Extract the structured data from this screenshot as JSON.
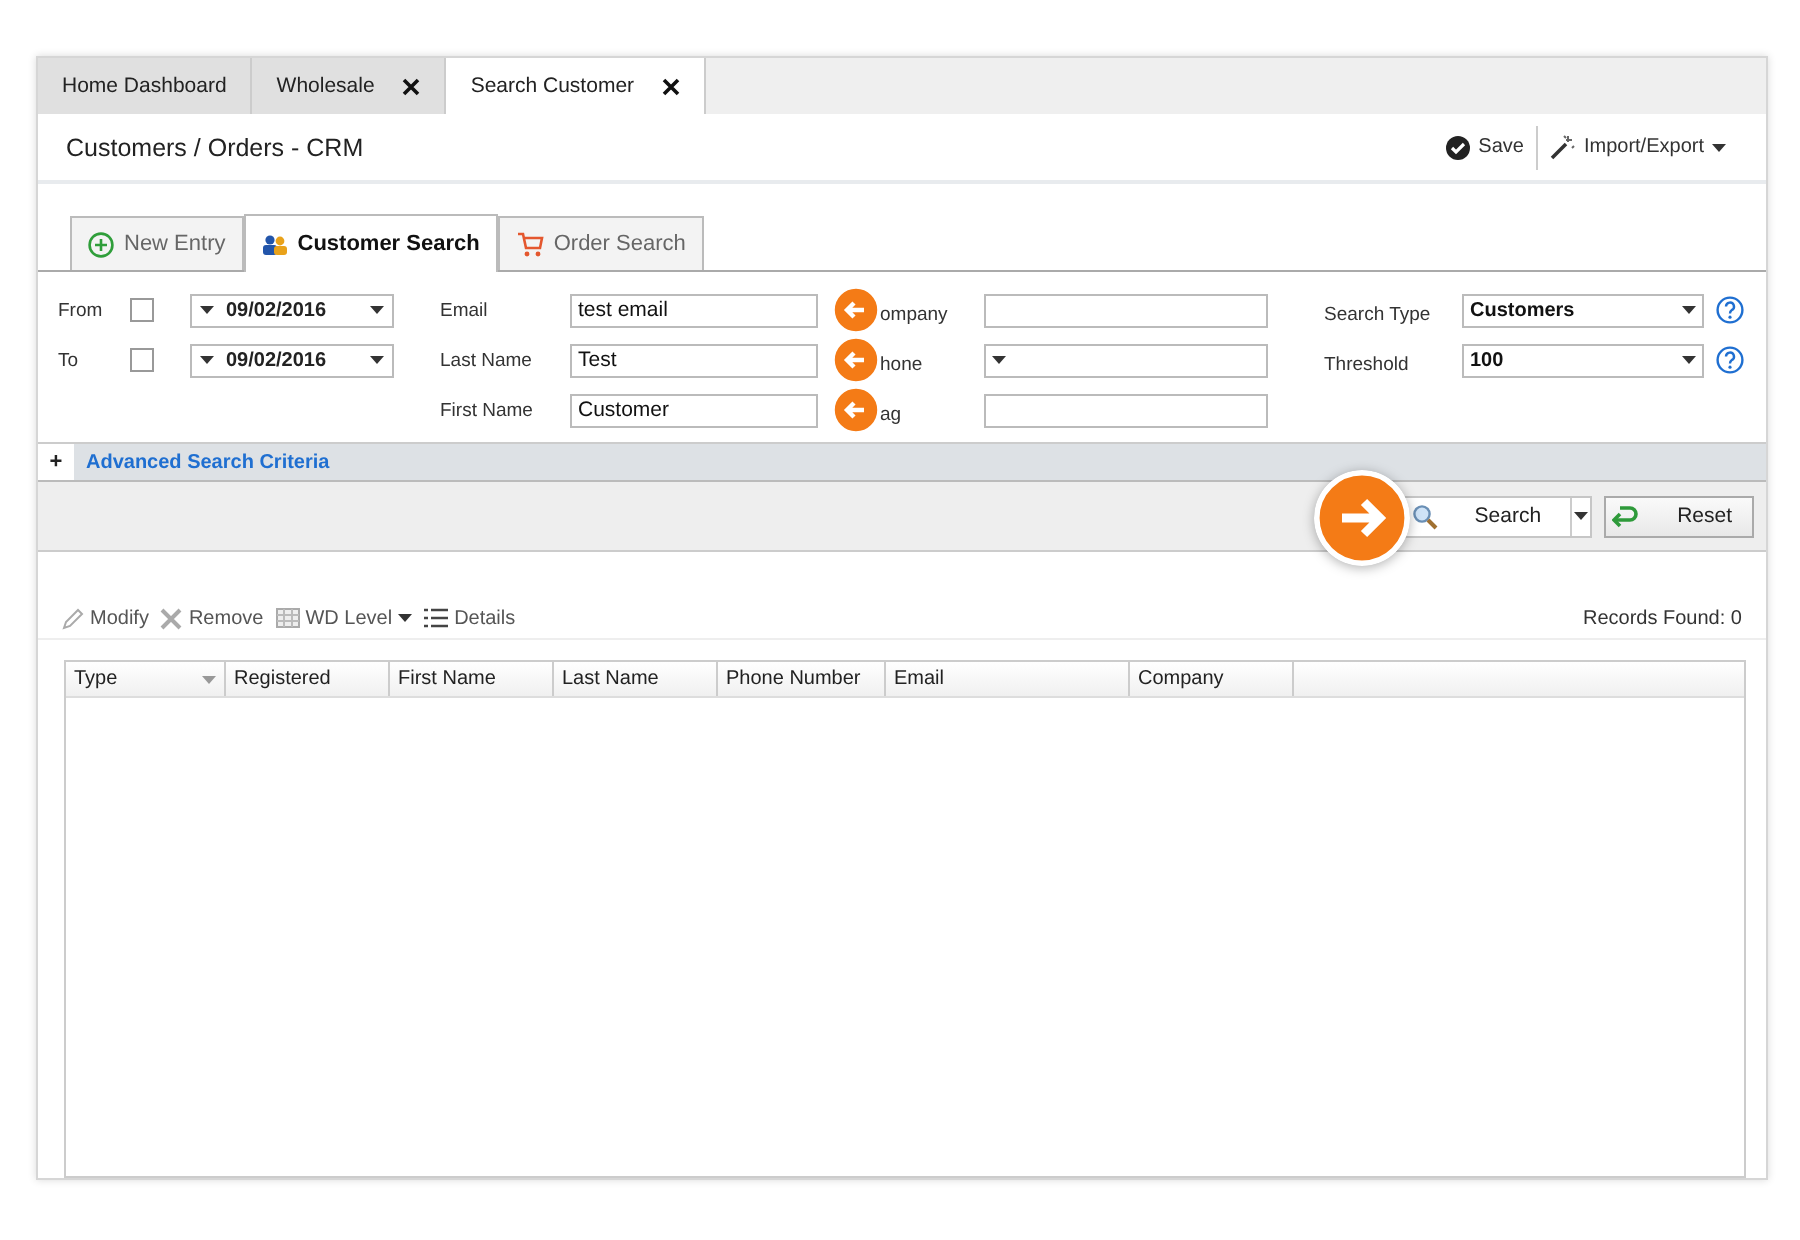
{
  "tabs": [
    {
      "label": "Home Dashboard",
      "selected": false,
      "closable": false
    },
    {
      "label": "Wholesale",
      "selected": false,
      "closable": true
    },
    {
      "label": "Search Customer",
      "selected": true,
      "closable": true
    }
  ],
  "page_title": "Customers / Orders - CRM",
  "actions": [
    {
      "label": "Save",
      "kind": "save"
    },
    {
      "label": "Import/Export",
      "kind": "menu"
    }
  ],
  "subtabs": [
    {
      "label": "New Entry",
      "selected": false,
      "kind": "new"
    },
    {
      "label": "Customer Search",
      "selected": true,
      "kind": "customers"
    },
    {
      "label": "Order Search",
      "selected": false,
      "kind": "cart"
    }
  ],
  "date_filters": [
    {
      "label": "From",
      "checked": false,
      "value": "09/02/2016"
    },
    {
      "label": "To",
      "checked": false,
      "value": "09/02/2016"
    }
  ],
  "name_fields": [
    {
      "label": "Email",
      "value": "test email"
    },
    {
      "label": "Last Name",
      "value": "Test"
    },
    {
      "label": "First Name",
      "value": "Customer"
    }
  ],
  "other_fields": [
    {
      "label": "ompany",
      "kind": "text"
    },
    {
      "label": "hone",
      "kind": "select"
    },
    {
      "label": "ag",
      "kind": "text"
    }
  ],
  "options": [
    {
      "label": "Search Type",
      "value": "Customers"
    },
    {
      "label": "Threshold",
      "value": "100"
    }
  ],
  "advanced": {
    "symbol": "+",
    "label": "Advanced Search Criteria"
  },
  "search_buttons": [
    {
      "label": "Search",
      "kind": "search"
    },
    {
      "label": "Reset",
      "kind": "reset"
    }
  ],
  "result_actions": [
    {
      "label": "Modify",
      "kind": "edit"
    },
    {
      "label": "Remove",
      "kind": "remove"
    },
    {
      "label": "WD Level",
      "kind": "grid-menu"
    },
    {
      "label": "Details",
      "kind": "list"
    }
  ],
  "records_found": "Records Found: 0",
  "table": {
    "columns": [
      {
        "label": "Type",
        "has_menu": true
      },
      {
        "label": "Registered",
        "has_menu": false
      },
      {
        "label": "First Name",
        "has_menu": false
      },
      {
        "label": "Last Name",
        "has_menu": false
      },
      {
        "label": "Phone Number",
        "has_menu": false
      },
      {
        "label": "Email",
        "has_menu": false
      },
      {
        "label": "Company",
        "has_menu": false
      }
    ]
  }
}
